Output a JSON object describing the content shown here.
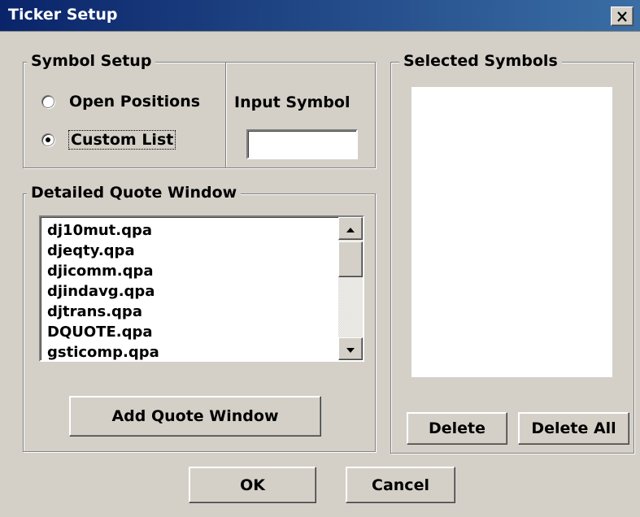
{
  "window": {
    "title": "Ticker Setup",
    "close_glyph": "✕"
  },
  "symbol_setup": {
    "label": "Symbol Setup",
    "option_open_positions": "Open Positions",
    "option_custom_list": "Custom List",
    "selected_option": "Custom List",
    "input_label": "Input Symbol",
    "input_value": ""
  },
  "detailed_quote": {
    "label": "Detailed Quote Window",
    "items": [
      "dj10mut.qpa",
      "djeqty.qpa",
      "djicomm.qpa",
      "djindavg.qpa",
      "djtrans.qpa",
      "DQUOTE.qpa",
      "gsticomp.qpa"
    ],
    "add_button": "Add Quote Window"
  },
  "selected_symbols": {
    "label": "Selected Symbols",
    "items": [],
    "delete_button": "Delete",
    "delete_all_button": "Delete All"
  },
  "footer": {
    "ok_button": "OK",
    "cancel_button": "Cancel"
  },
  "colors": {
    "dialog_bg": "#d4d0c8",
    "titlebar_start": "#0a246a",
    "titlebar_end": "#3a6ea5",
    "title_text": "#ffffff"
  },
  "icons": {
    "close": "close-icon",
    "scroll_up": "arrow-up-icon",
    "scroll_down": "arrow-down-icon",
    "radio_selected": "radio-selected-icon",
    "radio_unselected": "radio-unselected-icon"
  }
}
